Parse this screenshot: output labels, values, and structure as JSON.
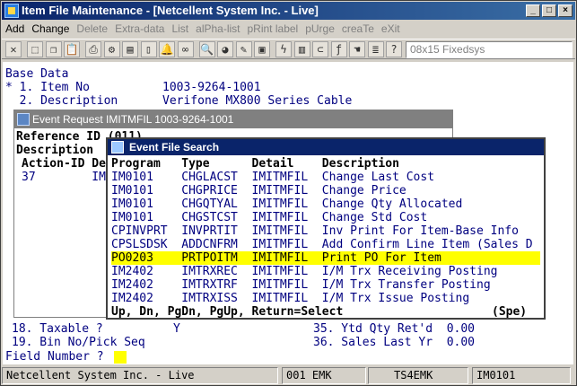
{
  "window": {
    "title": "Item File Maintenance - [Netcellent System Inc. - Live]"
  },
  "menu": [
    {
      "label": "Add",
      "enabled": true
    },
    {
      "label": "Change",
      "enabled": true
    },
    {
      "label": "Delete",
      "enabled": false
    },
    {
      "label": "Extra-data",
      "enabled": false
    },
    {
      "label": "List",
      "enabled": false
    },
    {
      "label": "alPha-list",
      "enabled": false
    },
    {
      "label": "pRint label",
      "enabled": false
    },
    {
      "label": "pUrge",
      "enabled": false
    },
    {
      "label": "creaTe",
      "enabled": false
    },
    {
      "label": "eXit",
      "enabled": false
    }
  ],
  "toolbar": {
    "icons": [
      "close-icon",
      "select-icon",
      "copy-icon",
      "paste-icon",
      "print-icon",
      "settings-icon",
      "document-icon",
      "page-icon",
      "bell-icon",
      "binoculars-icon",
      "magnifier-icon",
      "globe-icon",
      "pen-icon",
      "image-icon",
      "lightning-icon",
      "lock-icon",
      "link-icon",
      "function-icon",
      "help-hand-icon",
      "list-icon",
      "help-pointer-icon"
    ],
    "font": "08x15 Fixedsys"
  },
  "term": {
    "section": "Base Data",
    "item_no_label": "* 1. Item No",
    "item_no_value": "1003-9264-1001",
    "desc_label": "  2. Description",
    "desc_value": "Verifone MX800 Series Cable",
    "ref_line": "Reference ID (011)",
    "desc_line": "Description",
    "action_head": "Action-ID De",
    "action_row": "37        IM",
    "taxable_line": "18. Taxable ?          Y",
    "ytd_line": "35. Ytd Qty Ret'd  0.00",
    "bin_line": "19. Bin No/Pick Seq",
    "sales_line": "36. Sales Last Yr  0.00",
    "field_prompt": "Field Number ?"
  },
  "event_window": {
    "title": "Event Request IMITMFIL 1003-9264-1001"
  },
  "search": {
    "title": "Event File Search",
    "columns": [
      "Program",
      "Type",
      "Detail",
      "Description"
    ],
    "rows": [
      {
        "program": "IM0101",
        "type": "CHGLACST",
        "detail": "IMITMFIL",
        "desc": "Change Last Cost"
      },
      {
        "program": "IM0101",
        "type": "CHGPRICE",
        "detail": "IMITMFIL",
        "desc": "Change Price"
      },
      {
        "program": "IM0101",
        "type": "CHGQTYAL",
        "detail": "IMITMFIL",
        "desc": "Change Qty Allocated"
      },
      {
        "program": "IM0101",
        "type": "CHGSTCST",
        "detail": "IMITMFIL",
        "desc": "Change Std Cost"
      },
      {
        "program": "CPINVPRT",
        "type": "INVPRTIT",
        "detail": "IMITMFIL",
        "desc": "Inv Print For Item-Base Info"
      },
      {
        "program": "CPSLSDSK",
        "type": "ADDCNFRM",
        "detail": "IMITMFIL",
        "desc": "Add Confirm Line Item (Sales D"
      },
      {
        "program": "PO0203",
        "type": "PRTPOITM",
        "detail": "IMITMFIL",
        "desc": "Print PO For Item"
      },
      {
        "program": "IM2402",
        "type": "IMTRXREC",
        "detail": "IMITMFIL",
        "desc": "I/M Trx Receiving Posting"
      },
      {
        "program": "IM2402",
        "type": "IMTRXTRF",
        "detail": "IMITMFIL",
        "desc": "I/M Trx Transfer Posting"
      },
      {
        "program": "IM2402",
        "type": "IMTRXISS",
        "detail": "IMITMFIL",
        "desc": "I/M Trx Issue Posting"
      }
    ],
    "selected_index": 6,
    "footer": "Up, Dn, PgDn, PgUp, Return=Select",
    "footer_right": "(Spe)"
  },
  "statusbar": {
    "company": "Netcellent System Inc. - Live",
    "user": "001 EMK",
    "terminal": "TS4EMK",
    "program": "IM0101"
  },
  "colors": {
    "title_active": "#0a246a",
    "selected_row": "#ffff00",
    "text": "#000080"
  }
}
